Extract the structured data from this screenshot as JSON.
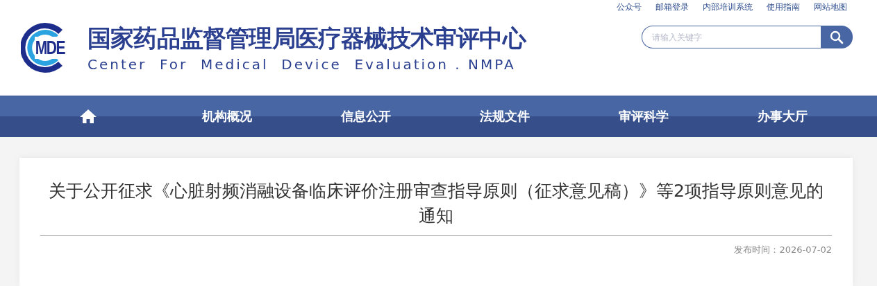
{
  "top_links": [
    "公众号",
    "邮箱登录",
    "内部培训系统",
    "使用指南",
    "网站地图"
  ],
  "logo": {
    "mark": "MDE",
    "title": "国家药品监督管理局医疗器械技术审评中心",
    "subtitle": "Center  For  Medical  Device  Evaluation . NMPA"
  },
  "search": {
    "placeholder": "请输入关键字"
  },
  "nav": [
    {
      "kind": "home"
    },
    {
      "kind": "text",
      "label": "机构概况"
    },
    {
      "kind": "text",
      "label": "信息公开"
    },
    {
      "kind": "text",
      "label": "法规文件"
    },
    {
      "kind": "text",
      "label": "审评科学"
    },
    {
      "kind": "text",
      "label": "办事大厅"
    }
  ],
  "article": {
    "title": "关于公开征求《心脏射频消融设备临床评价注册审查指导原则（征求意见稿）》等2项指导原则意见的通知",
    "published": "发布时间：2026-07-02"
  }
}
